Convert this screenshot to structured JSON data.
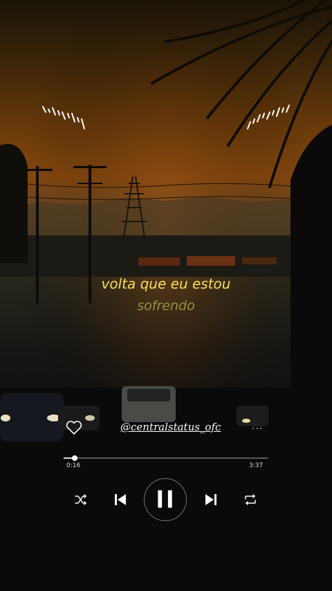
{
  "lyrics": {
    "current": "volta que eu estou",
    "next": "sofrendo"
  },
  "track": {
    "handle": "@centralstatus_ofc",
    "more_label": "...",
    "elapsed": "0:16",
    "duration": "3:37",
    "progress_fraction": 0.054
  },
  "icons": {
    "like": "heart-outline-icon",
    "shuffle": "shuffle-icon",
    "previous": "skip-previous-icon",
    "play_state": "pause-icon",
    "next": "skip-next-icon",
    "repeat": "repeat-icon",
    "left_wave": "audio-wave-icon",
    "right_wave": "audio-wave-icon"
  },
  "colors": {
    "lyric_current": "#f2e05a",
    "lyric_next": "#9a9140",
    "sky_orange": "#8a4a10"
  }
}
